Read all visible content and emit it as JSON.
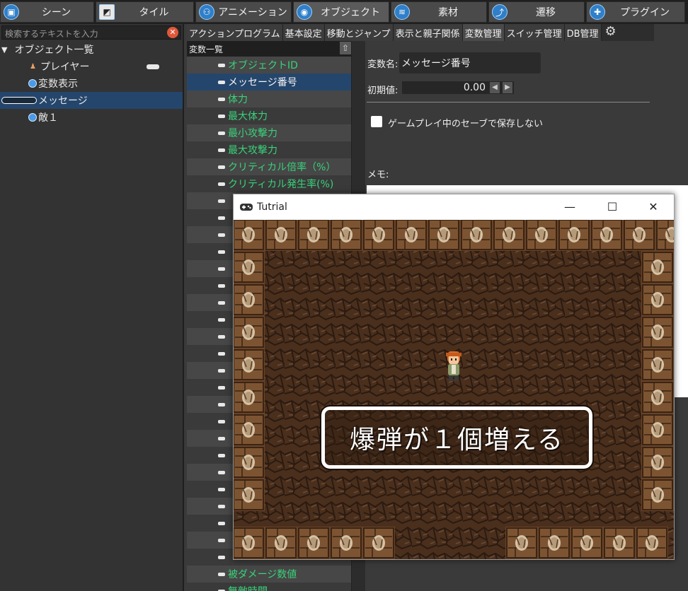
{
  "toolbar": {
    "buttons": [
      {
        "label": "シーン",
        "icon": "scene-icon"
      },
      {
        "label": "タイル",
        "icon": "tile-icon"
      },
      {
        "label": "アニメーション",
        "icon": "animation-icon"
      },
      {
        "label": "オブジェクト",
        "icon": "object-icon"
      },
      {
        "label": "素材",
        "icon": "layers-icon"
      },
      {
        "label": "遷移",
        "icon": "transition-icon"
      },
      {
        "label": "プラグイン",
        "icon": "puzzle-icon"
      }
    ]
  },
  "left": {
    "search_placeholder": "検索するテキストを入力",
    "tree": {
      "root": "オブジェクト一覧",
      "items": [
        "プレイヤー",
        "変数表示",
        "メッセージ",
        "敵１"
      ]
    }
  },
  "tabs": [
    "アクションプログラム",
    "基本設定",
    "移動とジャンプ",
    "表示と親子関係",
    "変数管理",
    "スイッチ管理",
    "DB管理"
  ],
  "variables": {
    "header": "変数一覧",
    "items": [
      "オブジェクトID",
      "メッセージ番号",
      "体力",
      "最大体力",
      "最小攻撃力",
      "最大攻撃力",
      "クリティカル倍率（%）",
      "クリティカル発生率(%)",
      "",
      "",
      "",
      "",
      "",
      "",
      "",
      "",
      "",
      "",
      "",
      "",
      "",
      "",
      "",
      "",
      "",
      "",
      "",
      "",
      "",
      "",
      "被ダメージ数値",
      "無敵時間"
    ]
  },
  "detail": {
    "name_label": "変数名:",
    "name_value": "メッセージ番号",
    "init_label": "初期値:",
    "init_value": "0.00",
    "checkbox_label": "ゲームプレイ中のセーブで保存しない",
    "memo_label": "メモ:"
  },
  "game_window": {
    "title": "Tutrial",
    "message": "爆弾が１個増える"
  },
  "colors": {
    "selection": "#25466c",
    "variable_text": "#39d27a",
    "accent_icon": "#2f7fc9"
  }
}
